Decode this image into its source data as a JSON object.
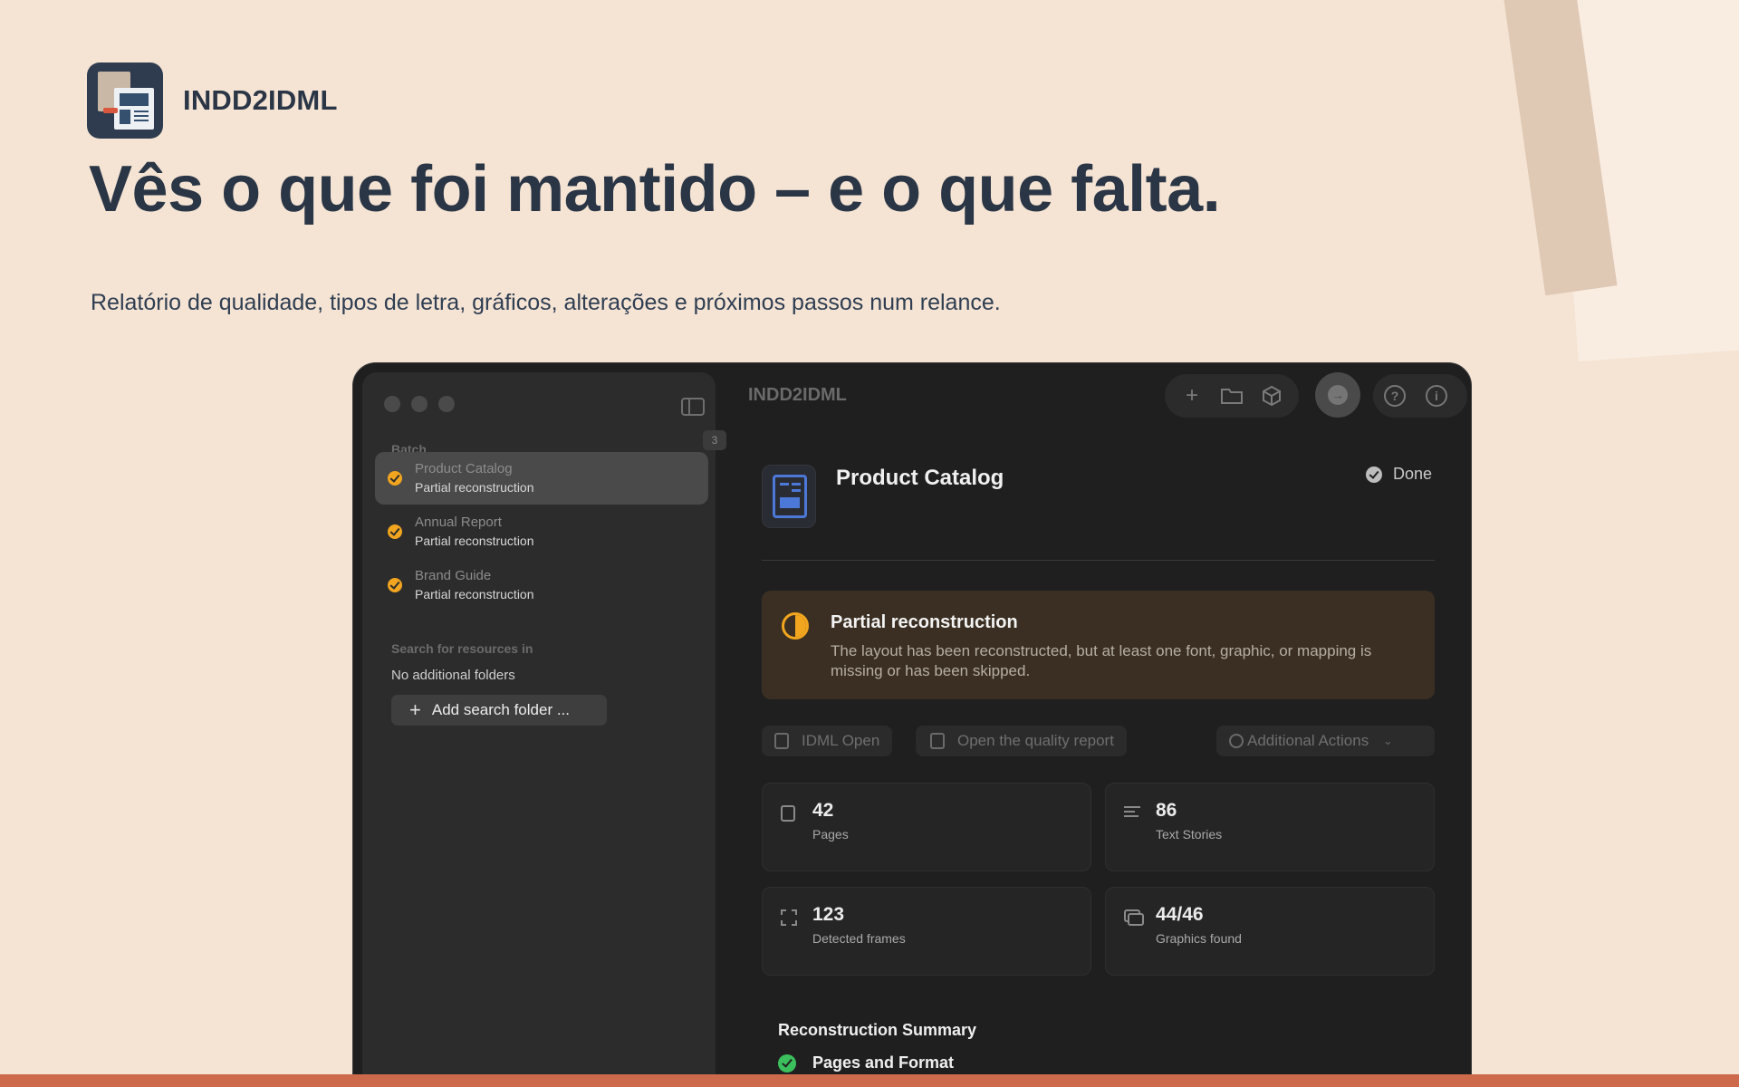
{
  "brand": {
    "name": "INDD2IDML"
  },
  "headline": "Vês o que foi mantido – e o que falta.",
  "subline": "Relatório de qualidade, tipos de letra, gráficos, alterações e próximos passos num relance.",
  "window": {
    "title": "INDD2IDML",
    "sidebar": {
      "batch_label": "Batch",
      "batch_count": "3",
      "items": [
        {
          "title": "Product Catalog",
          "status": "Partial reconstruction",
          "selected": true
        },
        {
          "title": "Annual Report",
          "status": "Partial reconstruction",
          "selected": false
        },
        {
          "title": "Brand Guide",
          "status": "Partial reconstruction",
          "selected": false
        }
      ],
      "search_label": "Search for resources in",
      "no_folders": "No additional folders",
      "add_folder": "Add search folder ..."
    },
    "toolbar": {
      "icons": [
        "plus-icon",
        "folder-icon",
        "package-icon",
        "convert-icon",
        "help-icon",
        "info-icon"
      ]
    },
    "document": {
      "title": "Product Catalog",
      "status": "Done",
      "banner": {
        "title": "Partial reconstruction",
        "text": "The layout has been reconstructed, but at least one font, graphic, or mapping is missing or has been skipped."
      },
      "actions": {
        "open_idml": "IDML Open",
        "quality_report": "Open the quality report",
        "more": "Additional Actions"
      },
      "stats": [
        {
          "value": "42",
          "label": "Pages"
        },
        {
          "value": "86",
          "label": "Text Stories"
        },
        {
          "value": "123",
          "label": "Detected frames"
        },
        {
          "value": "44/46",
          "label": "Graphics found"
        }
      ],
      "summary": {
        "title": "Reconstruction Summary",
        "rows": [
          {
            "label": "Pages and Format"
          }
        ]
      }
    }
  },
  "colors": {
    "background": "#f5e4d4",
    "accent_orange": "#f2a51f",
    "accent_blue": "#4c78d8",
    "success_green": "#3bbf5d",
    "stripe": "#cd6a4c"
  }
}
